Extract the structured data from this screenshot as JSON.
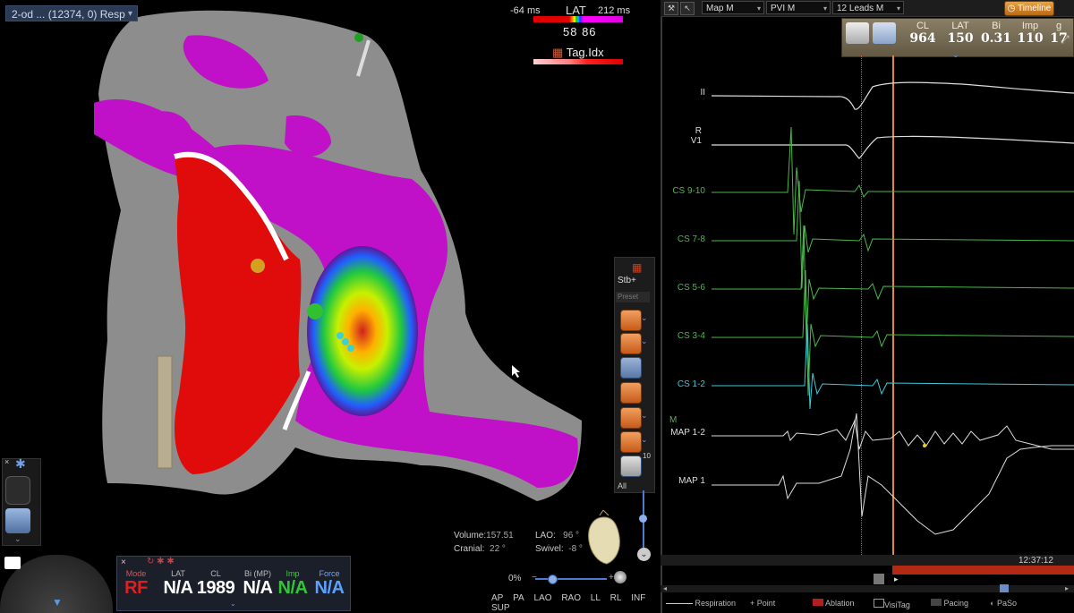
{
  "viewport": {
    "map_select": "2-od ... (12374, 0) Resp",
    "lat_scale": {
      "title": "LAT",
      "low": "-64 ms",
      "high": "212 ms",
      "values": "58  86"
    },
    "tag_title": "Tag.Idx",
    "stb": {
      "label": "Stb+",
      "preset": "Preset",
      "all": "All",
      "level": "10"
    },
    "info": {
      "volume_label": "Volume:",
      "volume": "157.51",
      "cranial_label": "Cranial:",
      "cranial": "22 °",
      "lao_label": "LAO:",
      "lao": "96 °",
      "swivel_label": "Swivel:",
      "swivel": "-8 °"
    },
    "zoom": "0%",
    "views": [
      "AP",
      "PA",
      "LAO",
      "RAO",
      "LL",
      "RL",
      "INF",
      "SUP"
    ]
  },
  "status": {
    "mode_label": "Mode",
    "mode": "RF",
    "lat_label": "LAT",
    "lat": "N/A",
    "cl_label": "CL",
    "cl": "1989",
    "bi_label": "Bi (MP)",
    "bi": "N/A",
    "imp_label": "Imp",
    "imp": "N/A",
    "force_label": "Force",
    "force": "N/A"
  },
  "right": {
    "toolbar": {
      "map": "Map M",
      "pvi": "PVI M",
      "leads": "12 Leads M",
      "timeline": "Timeline"
    },
    "measure": {
      "cl_label": "CL",
      "cl": "964",
      "lat_label": "LAT",
      "lat": "150",
      "bi_label": "Bi",
      "bi": "0.31",
      "imp_label": "Imp",
      "imp": "110",
      "g_label": "g",
      "g": "17"
    },
    "channels": [
      {
        "name": "II",
        "color": "#dddddd"
      },
      {
        "name": "R\nV1",
        "color": "#dddddd"
      },
      {
        "name": "CS 9-10",
        "color": "#4ab84a"
      },
      {
        "name": "CS 7-8",
        "color": "#4ab84a"
      },
      {
        "name": "CS 5-6",
        "color": "#4ab84a"
      },
      {
        "name": "CS 3-4",
        "color": "#4ab84a"
      },
      {
        "name": "CS 1-2",
        "color": "#40c8d8"
      },
      {
        "name": "M",
        "color": "#4ab84a"
      },
      {
        "name": "MAP 1-2",
        "color": "#dddddd"
      },
      {
        "name": "MAP 1",
        "color": "#dddddd"
      }
    ],
    "clock": "12:37:12",
    "legend": [
      "Respiration",
      "Point",
      "Ablation",
      "VisiTag",
      "Pacing",
      "PaSo"
    ]
  },
  "colors": {
    "rf": "#e02020",
    "imp": "#30c830",
    "force": "#5aa0ff",
    "accent": "#e28a3a"
  }
}
